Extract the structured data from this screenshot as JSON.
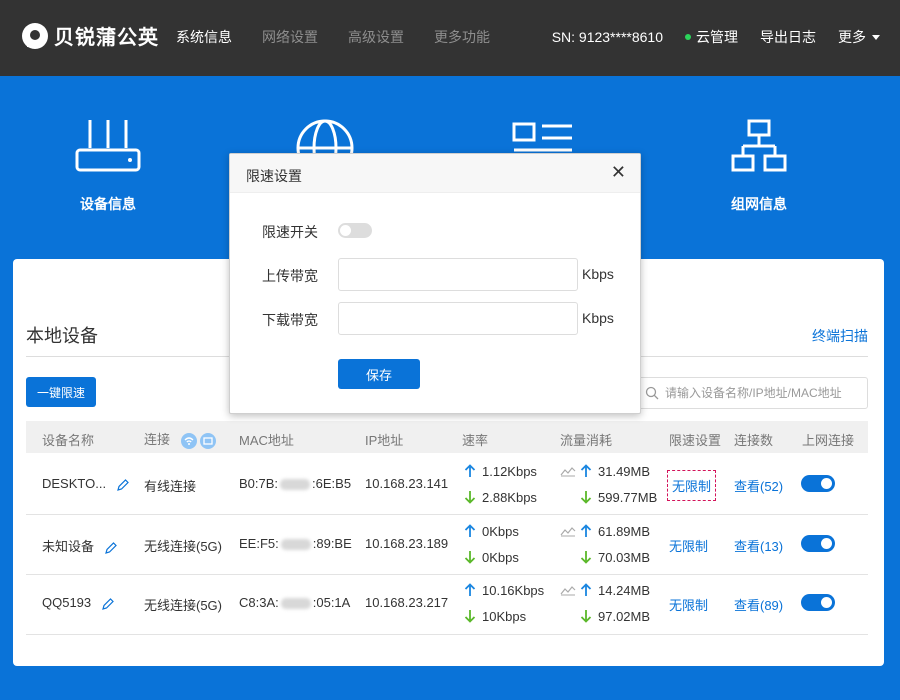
{
  "brand": {
    "name": "贝锐蒲公英"
  },
  "nav": {
    "items": [
      "系统信息",
      "网络设置",
      "高级设置",
      "更多功能"
    ]
  },
  "header": {
    "sn": "SN:  9123****8610",
    "cloud": "云管理",
    "export": "导出日志",
    "more": "更多"
  },
  "tiles": {
    "device_info": "设备信息",
    "network_info": "组网信息"
  },
  "panel": {
    "title": "本地设备",
    "scan": "终端扫描",
    "quick_limit": "一键限速",
    "search_placeholder": "请输入设备名称/IP地址/MAC地址"
  },
  "table": {
    "headers": [
      "设备名称",
      "连接",
      "MAC地址",
      "IP地址",
      "速率",
      "流量消耗",
      "限速设置",
      "连接数",
      "上网连接"
    ],
    "rows": [
      {
        "name": "DESKTO...",
        "conn": "有线连接",
        "mac_a": "B0:7B:",
        "mac_b": ":6E:B5",
        "ip": "10.168.23.141",
        "up": "1.12Kbps",
        "down": "2.88Kbps",
        "traffic_up": "31.49MB",
        "traffic_down": "599.77MB",
        "limit": "无限制",
        "count": "查看(52)",
        "online": true
      },
      {
        "name": "未知设备",
        "conn": "无线连接(5G)",
        "mac_a": "EE:F5:",
        "mac_b": ":89:BE",
        "ip": "10.168.23.189",
        "up": "0Kbps",
        "down": "0Kbps",
        "traffic_up": "61.89MB",
        "traffic_down": "70.03MB",
        "limit": "无限制",
        "count": "查看(13)",
        "online": true
      },
      {
        "name": "QQ5193",
        "conn": "无线连接(5G)",
        "mac_a": "C8:3A:",
        "mac_b": ":05:1A",
        "ip": "10.168.23.217",
        "up": "10.16Kbps",
        "down": "10Kbps",
        "traffic_up": "14.24MB",
        "traffic_down": "97.02MB",
        "limit": "无限制",
        "count": "查看(89)",
        "online": true
      }
    ]
  },
  "modal": {
    "title": "限速设置",
    "close": "✕",
    "switch_label": "限速开关",
    "upload_label": "上传带宽",
    "download_label": "下载带宽",
    "unit": "Kbps",
    "upload_value": "",
    "download_value": "",
    "save": "保存"
  },
  "colors": {
    "accent": "#0a73d8",
    "topbar": "#333333",
    "highlight_border": "#d3135a",
    "up_arrow": "#1a86e0",
    "down_arrow": "#5bb82a"
  }
}
